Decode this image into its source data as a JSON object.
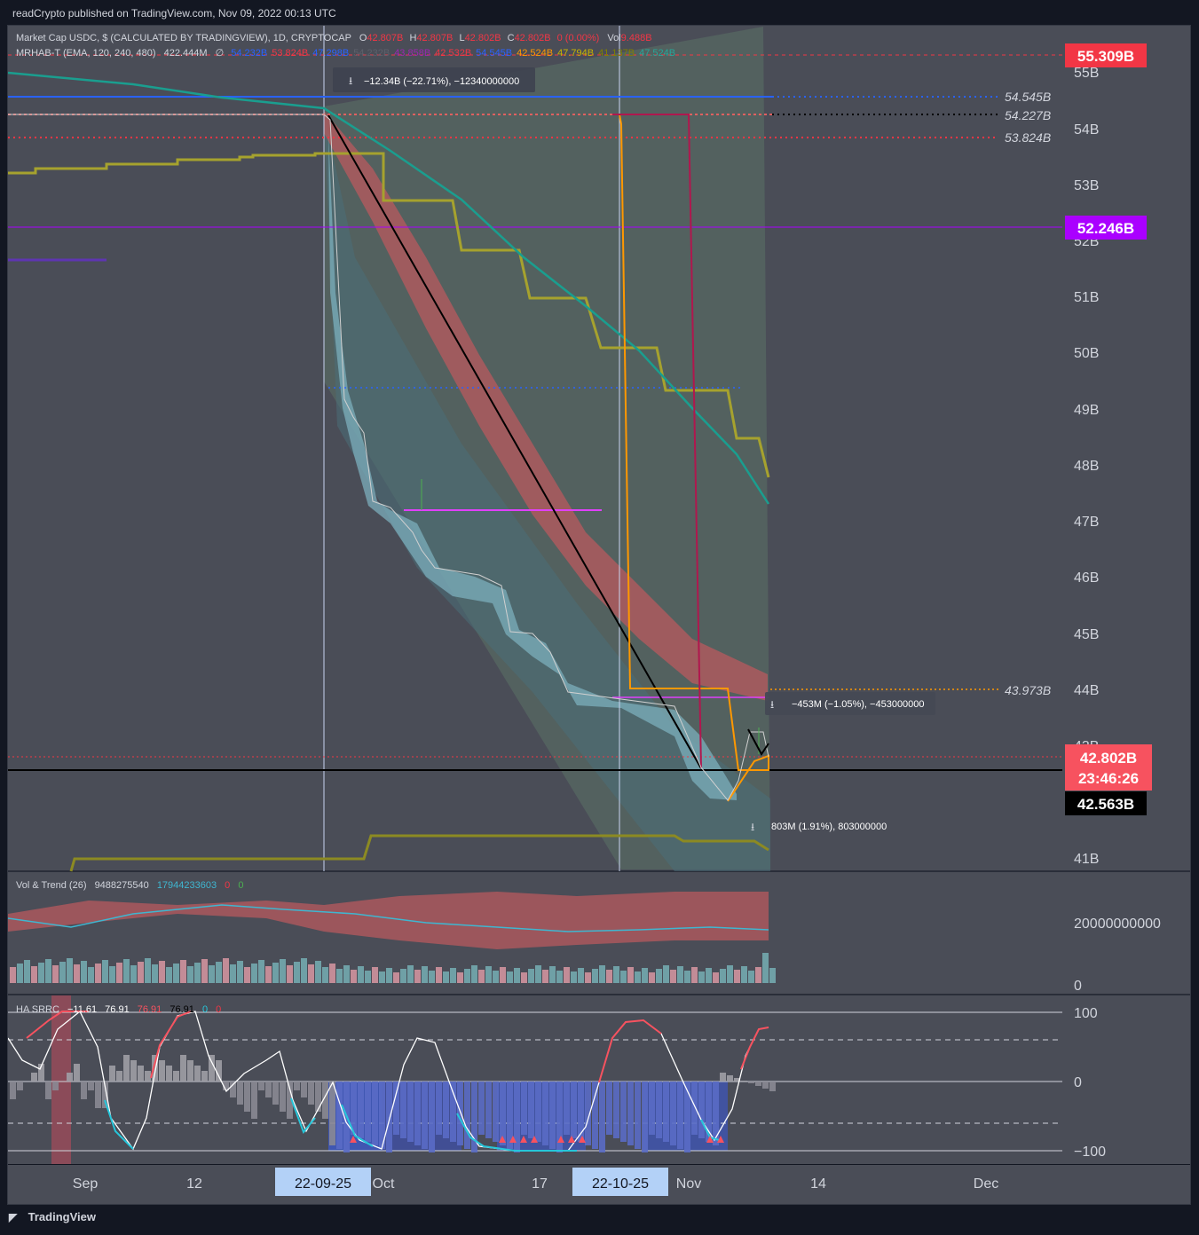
{
  "header": {
    "published": "readCrypto published on TradingView.com, Nov 09, 2022 00:13 UTC"
  },
  "footer": {
    "brand": "TradingView"
  },
  "legend": {
    "main": {
      "title": "Market Cap USDC, $ (CALCULATED BY TRADINGVIEW), 1D, CRYPTOCAP",
      "o_label": "O",
      "o": "42.807B",
      "h_label": "H",
      "h": "42.807B",
      "l_label": "L",
      "l": "42.802B",
      "c_label": "C",
      "c": "42.802B",
      "chg": "0 (0.00%)",
      "vol_label": "Vol",
      "vol": "9.488B"
    },
    "mrhab": {
      "name": "MRHAB-T (EMA, 120, 240, 480)",
      "v1": "422.444M",
      "v2": "∅",
      "vals": [
        {
          "v": "54.232B",
          "color": "#2962ff"
        },
        {
          "v": "53.824B",
          "color": "#f23645"
        },
        {
          "v": "47.298B",
          "color": "#2962ff"
        },
        {
          "v": "54.232B",
          "color": "#5d606b"
        },
        {
          "v": "43.858B",
          "color": "#9c27b0"
        },
        {
          "v": "42.532B",
          "color": "#f23645"
        },
        {
          "v": "54.545B",
          "color": "#2962ff"
        },
        {
          "v": "42.524B",
          "color": "#ff9800"
        },
        {
          "v": "47.794B",
          "color": "#c8b400"
        },
        {
          "v": "41.137B",
          "color": "#808000"
        },
        {
          "v": "47.524B",
          "color": "#26a69a"
        }
      ]
    },
    "vol": {
      "name": "Vol & Trend (26)",
      "v1": "9488275540",
      "v2": "17944233603",
      "v3": "0",
      "v4": "0"
    },
    "ha": {
      "name": "HA SRRC",
      "v1": "−11.61",
      "v2": "76.91",
      "v3": "76.91",
      "v4": "76.91",
      "v5": "0",
      "v6": "0"
    }
  },
  "measurements": [
    {
      "text": "−12.34B (−22.71%), −12340000000"
    },
    {
      "text": "−453M (−1.05%), −453000000"
    },
    {
      "text": "803M (1.91%), 803000000"
    }
  ],
  "price_axis": {
    "ticks": [
      "55B",
      "54B",
      "53B",
      "52B",
      "51B",
      "50B",
      "49B",
      "48B",
      "47B",
      "46B",
      "45B",
      "44B",
      "43B",
      "41B"
    ],
    "badges": [
      {
        "text": "55.309B",
        "bg": "#f23645",
        "fg": "#ffffff"
      },
      {
        "text": "52.246B",
        "bg": "#aa00ff",
        "fg": "#ffffff"
      },
      {
        "text": "42.802B",
        "text2": "23:46:26",
        "bg": "#f7525f",
        "fg": "#ffffff"
      },
      {
        "text": "42.563B",
        "bg": "#000000",
        "fg": "#ffffff"
      }
    ],
    "line_labels": [
      "54.545B",
      "54.227B",
      "53.824B",
      "43.973B"
    ]
  },
  "vol_axis": {
    "ticks": [
      "20000000000",
      "0"
    ]
  },
  "osc_axis": {
    "ticks": [
      "100",
      "0",
      "−100"
    ]
  },
  "time_axis": {
    "ticks": [
      "Sep",
      "12",
      "Oct",
      "17",
      "Nov",
      "14",
      "Dec"
    ],
    "highlights": [
      "22-09-25",
      "22-10-25"
    ]
  },
  "chart_data": {
    "type": "line",
    "title": "Market Cap USDC",
    "x": [
      "2022-08-28",
      "2022-09-04",
      "2022-09-11",
      "2022-09-18",
      "2022-09-25",
      "2022-10-02",
      "2022-10-09",
      "2022-10-16",
      "2022-10-23",
      "2022-10-30",
      "2022-11-06",
      "2022-11-09"
    ],
    "series": [
      {
        "name": "Market Cap USDC",
        "values": [
          54.23,
          54.22,
          54.25,
          54.24,
          54.2,
          47.4,
          46.1,
          45.0,
          43.9,
          42.6,
          42.56,
          42.8
        ]
      }
    ],
    "ylim": [
      40.8,
      55.6
    ],
    "last_price": 42.802,
    "grid": false
  }
}
